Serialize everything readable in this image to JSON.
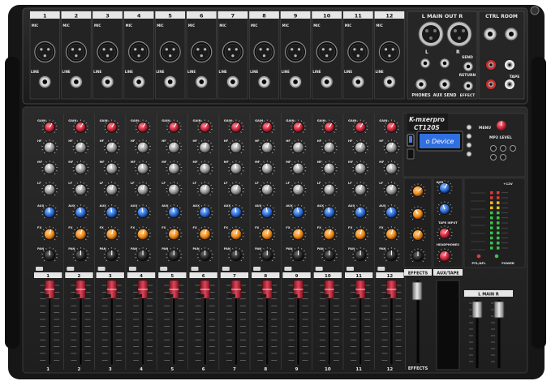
{
  "device": {
    "brand": "K-mxerpro",
    "model": "CT120S",
    "display_text": "o Device"
  },
  "top_panel": {
    "channel_numbers": [
      "1",
      "2",
      "3",
      "4",
      "5",
      "6",
      "7",
      "8",
      "9",
      "10",
      "11",
      "12"
    ],
    "main_out_label": "L  MAIN OUT  R",
    "ctrl_room_label": "CTRL ROOM",
    "mic_label": "MIC",
    "line_label": "LINE",
    "send_label": "SEND",
    "return_label": "RETURN",
    "effect_label": "EFFECT",
    "phones_label": "PHONES",
    "aux_send_label": "AUX SEND",
    "tape_label": "TAPE",
    "lr_l": "L",
    "lr_r": "R"
  },
  "channel_strip": {
    "gain_label": "GAIN",
    "hf_label": "HF",
    "mf_label": "MF",
    "lf_label": "LF",
    "aux_label": "AUX",
    "fx_label": "FX",
    "pan_label": "PAN",
    "fader_numbers": [
      "1",
      "2",
      "3",
      "4",
      "5",
      "6",
      "7",
      "8",
      "9",
      "10",
      "11",
      "12"
    ]
  },
  "master": {
    "menu_label": "MENU",
    "mp3_level_label": "MP3 LEVEL",
    "effects_label": "EFFECTS",
    "aux_tape_label": "AUX/TAPE",
    "main_label": "L  MAIN  R",
    "pfl_label": "PFL/AFL",
    "power_label": "POWER",
    "tape_input_label": "TAPE INPUT",
    "headphones_label": "HEADPHONES",
    "aux_ret_label": "AUX",
    "clip_label": "+12V"
  },
  "colors": {
    "chassis": "#1a1a1a",
    "panel": "#2a2a2a",
    "gain_knob": "#d0283c",
    "aux_knob": "#2f6fd6",
    "fx_knob": "#f08c1e",
    "eq_knob": "#bdbdbd",
    "fader_cap": "#c5283a",
    "display": "#2f6fe0"
  }
}
